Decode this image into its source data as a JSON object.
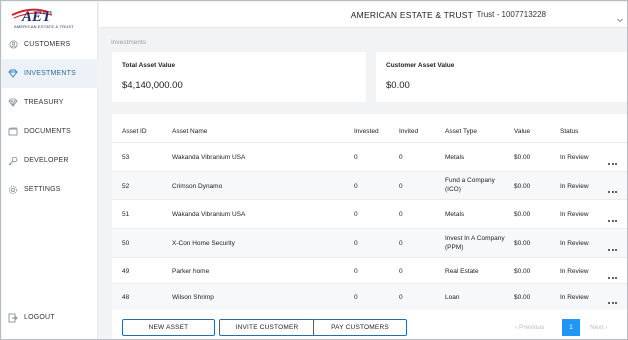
{
  "logo": {
    "letters": "AET",
    "subtitle": "AMERICAN ESTATE & TRUST"
  },
  "sidebar": {
    "items": [
      {
        "label": "CUSTOMERS",
        "icon": "customers-icon",
        "active": false
      },
      {
        "label": "INVESTMENTS",
        "icon": "diamond-icon",
        "active": true
      },
      {
        "label": "TREASURY",
        "icon": "treasury-icon",
        "active": false
      },
      {
        "label": "DOCUMENTS",
        "icon": "documents-icon",
        "active": false
      },
      {
        "label": "DEVELOPER",
        "icon": "key-icon",
        "active": false
      },
      {
        "label": "SETTINGS",
        "icon": "gear-icon",
        "active": false
      }
    ],
    "logout": "LOGOUT"
  },
  "header": {
    "company": "AMERICAN ESTATE & TRUST",
    "trust": "Trust - 1007713228"
  },
  "breadcrumb": "Investments",
  "summary": {
    "total_label": "Total Asset Value",
    "total_value": "$4,140,000.00",
    "customer_label": "Customer Asset Value",
    "customer_value": "$0.00"
  },
  "table": {
    "columns": [
      "Asset ID",
      "Asset Name",
      "Invested",
      "Invited",
      "Asset Type",
      "Value",
      "Status"
    ],
    "rows": [
      {
        "id": "53",
        "name": "Wakanda Vibranium USA",
        "invested": "0",
        "invited": "0",
        "type": [
          "Metals"
        ],
        "value": "$0.00",
        "status": "In Review"
      },
      {
        "id": "52",
        "name": "Crimson Dynamo",
        "invested": "0",
        "invited": "0",
        "type": [
          "Fund a Company",
          "(ICO)"
        ],
        "value": "$0.00",
        "status": "In Review"
      },
      {
        "id": "51",
        "name": "Wakanda Vibranium USA",
        "invested": "0",
        "invited": "0",
        "type": [
          "Metals"
        ],
        "value": "$0.00",
        "status": "In Review"
      },
      {
        "id": "50",
        "name": "X-Con Home Security",
        "invested": "0",
        "invited": "0",
        "type": [
          "Invest In A Company",
          "(PPM)"
        ],
        "value": "$0.00",
        "status": "In Review"
      },
      {
        "id": "49",
        "name": "Parker home",
        "invested": "0",
        "invited": "0",
        "type": [
          "Real Estate"
        ],
        "value": "$0.00",
        "status": "In Review"
      },
      {
        "id": "48",
        "name": "Wilson Shrimp",
        "invested": "0",
        "invited": "0",
        "type": [
          "Loan"
        ],
        "value": "$0.00",
        "status": "In Review"
      }
    ]
  },
  "actions": {
    "new_asset": "NEW ASSET",
    "invite_customer": "INVITE CUSTOMER",
    "pay_customers": "PAY CUSTOMERS"
  },
  "pagination": {
    "previous": "Previous",
    "current": "1",
    "next": "Next"
  },
  "colors": {
    "accent": "#2196f3",
    "brand_red": "#d0252f",
    "brand_navy": "#1f2f6b",
    "active_nav": "#2a6aa6"
  }
}
